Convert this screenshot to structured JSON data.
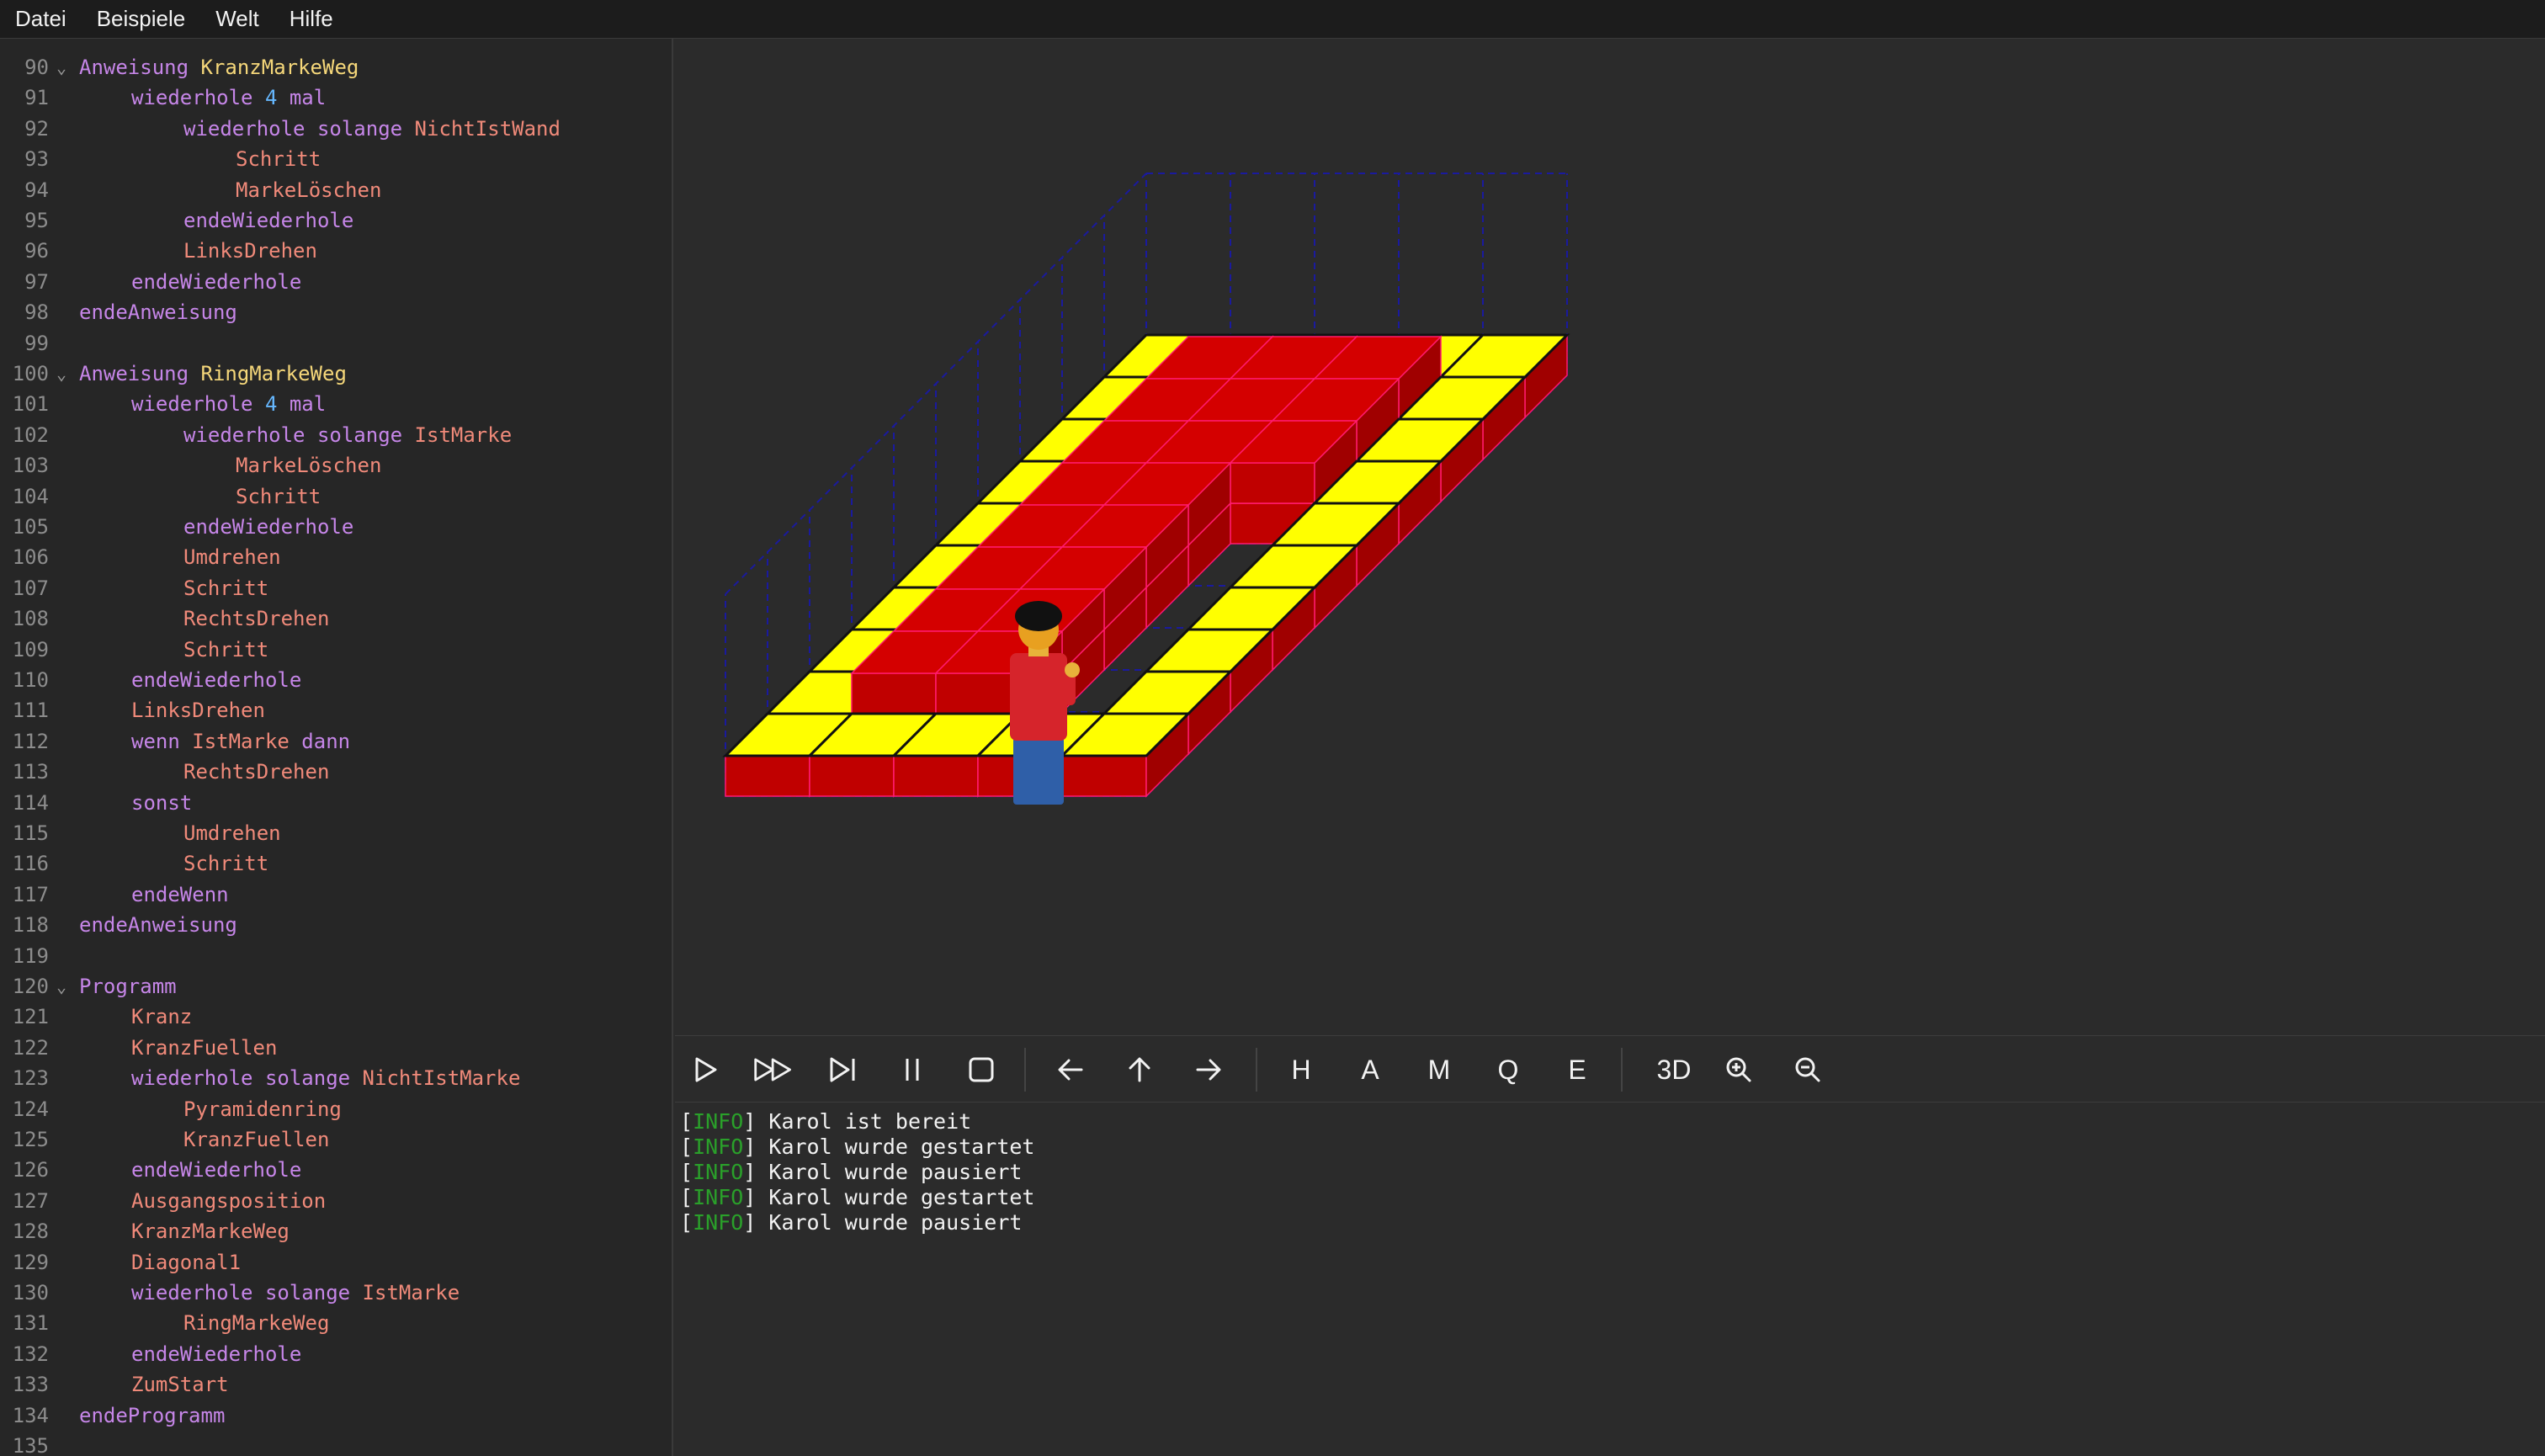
{
  "menubar": {
    "items": [
      "Datei",
      "Beispiele",
      "Welt",
      "Hilfe"
    ]
  },
  "editor": {
    "lines": [
      {
        "n": "90",
        "fold": true,
        "tokens": [
          [
            "kw",
            "Anweisung "
          ],
          [
            "name",
            "KranzMarkeWeg"
          ]
        ]
      },
      {
        "n": "91",
        "indent": 1,
        "tokens": [
          [
            "kw",
            "wiederhole "
          ],
          [
            "num",
            "4"
          ],
          [
            "kw",
            " mal"
          ]
        ]
      },
      {
        "n": "92",
        "indent": 2,
        "tokens": [
          [
            "kw",
            "wiederhole solange "
          ],
          [
            "cmd",
            "NichtIstWand"
          ]
        ]
      },
      {
        "n": "93",
        "indent": 3,
        "tokens": [
          [
            "cmd",
            "Schritt"
          ]
        ]
      },
      {
        "n": "94",
        "indent": 3,
        "tokens": [
          [
            "cmd",
            "MarkeLöschen"
          ]
        ]
      },
      {
        "n": "95",
        "indent": 2,
        "tokens": [
          [
            "kw",
            "endeWiederhole"
          ]
        ]
      },
      {
        "n": "96",
        "indent": 2,
        "tokens": [
          [
            "cmd",
            "LinksDrehen"
          ]
        ]
      },
      {
        "n": "97",
        "indent": 1,
        "tokens": [
          [
            "kw",
            "endeWiederhole"
          ]
        ]
      },
      {
        "n": "98",
        "indent": 0,
        "tokens": [
          [
            "kw",
            "endeAnweisung"
          ]
        ]
      },
      {
        "n": "99",
        "indent": 0,
        "tokens": []
      },
      {
        "n": "100",
        "fold": true,
        "tokens": [
          [
            "kw",
            "Anweisung "
          ],
          [
            "name",
            "RingMarkeWeg"
          ]
        ]
      },
      {
        "n": "101",
        "indent": 1,
        "tokens": [
          [
            "kw",
            "wiederhole "
          ],
          [
            "num",
            "4"
          ],
          [
            "kw",
            " mal"
          ]
        ]
      },
      {
        "n": "102",
        "indent": 2,
        "tokens": [
          [
            "kw",
            "wiederhole solange "
          ],
          [
            "cmd",
            "IstMarke"
          ]
        ]
      },
      {
        "n": "103",
        "indent": 3,
        "tokens": [
          [
            "cmd",
            "MarkeLöschen"
          ]
        ]
      },
      {
        "n": "104",
        "indent": 3,
        "tokens": [
          [
            "cmd",
            "Schritt"
          ]
        ]
      },
      {
        "n": "105",
        "indent": 2,
        "tokens": [
          [
            "kw",
            "endeWiederhole"
          ]
        ]
      },
      {
        "n": "106",
        "indent": 2,
        "tokens": [
          [
            "cmd",
            "Umdrehen"
          ]
        ]
      },
      {
        "n": "107",
        "indent": 2,
        "tokens": [
          [
            "cmd",
            "Schritt"
          ]
        ]
      },
      {
        "n": "108",
        "indent": 2,
        "tokens": [
          [
            "cmd",
            "RechtsDrehen"
          ]
        ]
      },
      {
        "n": "109",
        "indent": 2,
        "tokens": [
          [
            "cmd",
            "Schritt"
          ]
        ]
      },
      {
        "n": "110",
        "indent": 1,
        "tokens": [
          [
            "kw",
            "endeWiederhole"
          ]
        ]
      },
      {
        "n": "111",
        "indent": 1,
        "tokens": [
          [
            "cmd",
            "LinksDrehen"
          ]
        ]
      },
      {
        "n": "112",
        "indent": 1,
        "tokens": [
          [
            "kw",
            "wenn "
          ],
          [
            "cmd",
            "IstMarke"
          ],
          [
            "kw",
            " dann"
          ]
        ]
      },
      {
        "n": "113",
        "indent": 2,
        "tokens": [
          [
            "cmd",
            "RechtsDrehen"
          ]
        ]
      },
      {
        "n": "114",
        "indent": 1,
        "tokens": [
          [
            "kw",
            "sonst"
          ]
        ]
      },
      {
        "n": "115",
        "indent": 2,
        "tokens": [
          [
            "cmd",
            "Umdrehen"
          ]
        ]
      },
      {
        "n": "116",
        "indent": 2,
        "tokens": [
          [
            "cmd",
            "Schritt"
          ]
        ]
      },
      {
        "n": "117",
        "indent": 1,
        "tokens": [
          [
            "kw",
            "endeWenn"
          ]
        ]
      },
      {
        "n": "118",
        "indent": 0,
        "tokens": [
          [
            "kw",
            "endeAnweisung"
          ]
        ]
      },
      {
        "n": "119",
        "indent": 0,
        "tokens": []
      },
      {
        "n": "120",
        "fold": true,
        "tokens": [
          [
            "kw",
            "Programm"
          ]
        ]
      },
      {
        "n": "121",
        "indent": 1,
        "tokens": [
          [
            "cmd",
            "Kranz"
          ]
        ]
      },
      {
        "n": "122",
        "indent": 1,
        "tokens": [
          [
            "cmd",
            "KranzFuellen"
          ]
        ]
      },
      {
        "n": "123",
        "indent": 1,
        "tokens": [
          [
            "kw",
            "wiederhole solange "
          ],
          [
            "cmd",
            "NichtIstMarke"
          ]
        ]
      },
      {
        "n": "124",
        "indent": 2,
        "tokens": [
          [
            "cmd",
            "Pyramidenring"
          ]
        ]
      },
      {
        "n": "125",
        "indent": 2,
        "tokens": [
          [
            "cmd",
            "KranzFuellen"
          ]
        ]
      },
      {
        "n": "126",
        "indent": 1,
        "tokens": [
          [
            "kw",
            "endeWiederhole"
          ]
        ]
      },
      {
        "n": "127",
        "indent": 1,
        "tokens": [
          [
            "cmd",
            "Ausgangsposition"
          ]
        ]
      },
      {
        "n": "128",
        "indent": 1,
        "tokens": [
          [
            "cmd",
            "KranzMarkeWeg"
          ]
        ]
      },
      {
        "n": "129",
        "indent": 1,
        "tokens": [
          [
            "cmd",
            "Diagonal1"
          ]
        ]
      },
      {
        "n": "130",
        "indent": 1,
        "tokens": [
          [
            "kw",
            "wiederhole solange "
          ],
          [
            "cmd",
            "IstMarke"
          ]
        ]
      },
      {
        "n": "131",
        "indent": 2,
        "tokens": [
          [
            "cmd",
            "RingMarkeWeg"
          ]
        ]
      },
      {
        "n": "132",
        "indent": 1,
        "tokens": [
          [
            "kw",
            "endeWiederhole"
          ]
        ]
      },
      {
        "n": "133",
        "indent": 1,
        "tokens": [
          [
            "cmd",
            "ZumStart"
          ]
        ]
      },
      {
        "n": "134",
        "indent": 0,
        "tokens": [
          [
            "kw",
            "endeProgramm"
          ]
        ]
      },
      {
        "n": "135",
        "indent": 0,
        "tokens": []
      }
    ]
  },
  "toolbar": {
    "letters": {
      "h": "H",
      "a": "A",
      "m": "M",
      "q": "Q",
      "e": "E",
      "view3d": "3D"
    }
  },
  "log": {
    "entries": [
      {
        "level": "INFO",
        "msg": "Karol ist bereit"
      },
      {
        "level": "INFO",
        "msg": "Karol wurde gestartet"
      },
      {
        "level": "INFO",
        "msg": "Karol wurde pausiert"
      },
      {
        "level": "INFO",
        "msg": "Karol wurde gestartet"
      },
      {
        "level": "INFO",
        "msg": "Karol wurde pausiert"
      }
    ]
  },
  "colors": {
    "keyword": "#c686e8",
    "command": "#f08a7a",
    "number": "#66b8ff",
    "name": "#f5d77a",
    "marker": "#ffff00",
    "brick": "#c00000",
    "grid": "#1a1a9e",
    "log_level": "#2aa02a"
  }
}
